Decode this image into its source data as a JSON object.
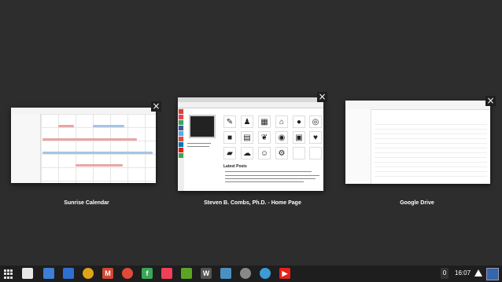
{
  "windows": [
    {
      "title": "Sunrise Calendar",
      "close": "×"
    },
    {
      "title": "Steven B. Combs, Ph.D. - Home Page",
      "close": "×"
    },
    {
      "title": "Google Drive",
      "close": "×"
    }
  ],
  "shelf": {
    "apps": [
      {
        "name": "store",
        "label": "",
        "color": "#e9e9e9"
      },
      {
        "name": "files",
        "label": "",
        "color": "#3d7fd6"
      },
      {
        "name": "docs",
        "label": "",
        "color": "#2f6fd0"
      },
      {
        "name": "chrome",
        "label": "",
        "color": "#e0a419"
      },
      {
        "name": "gmail",
        "label": "M",
        "color": "#d14836"
      },
      {
        "name": "red-circle",
        "label": "",
        "color": "#e04a3a"
      },
      {
        "name": "feedly",
        "label": "f",
        "color": "#3aa757"
      },
      {
        "name": "pocket",
        "label": "",
        "color": "#ee4056"
      },
      {
        "name": "evernote",
        "label": "",
        "color": "#5ba525"
      },
      {
        "name": "writer",
        "label": "W",
        "color": "#555555"
      },
      {
        "name": "photo",
        "label": "",
        "color": "#4a90c0"
      },
      {
        "name": "camera",
        "label": "",
        "color": "#888888"
      },
      {
        "name": "settings",
        "label": "",
        "color": "#3b9bd6"
      },
      {
        "name": "youtube",
        "label": "▶",
        "color": "#e62117"
      }
    ],
    "notification_count": "0",
    "time": "16:07"
  },
  "blog": {
    "heading": "Latest Posts"
  }
}
